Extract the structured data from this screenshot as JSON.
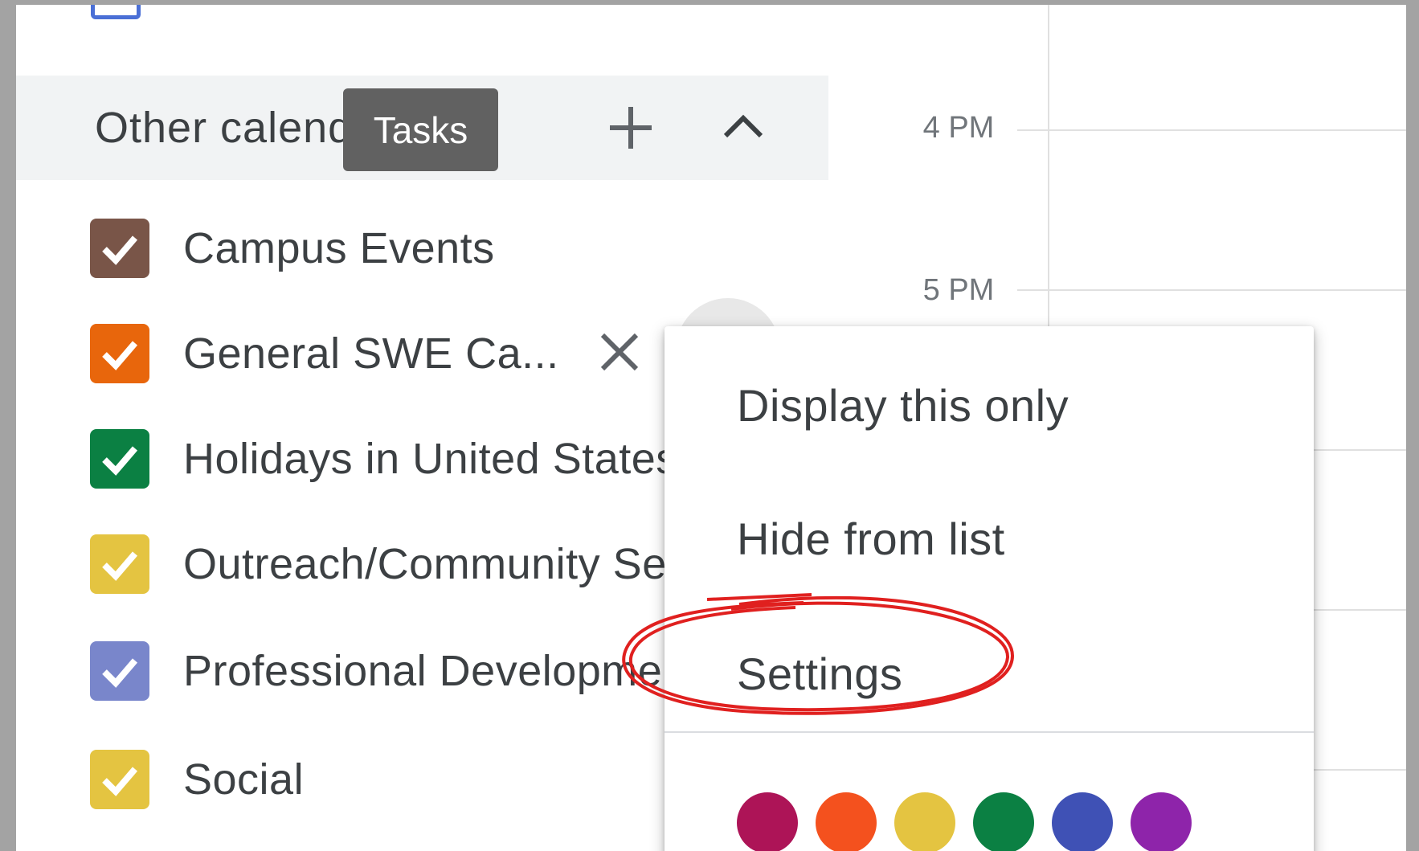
{
  "times": [
    "4 PM",
    "5 PM"
  ],
  "section": {
    "title": "Other calendars",
    "tooltip": "Tasks"
  },
  "calendars": [
    {
      "label": "Campus Events",
      "color": "#795548"
    },
    {
      "label": "General SWE Ca...",
      "color": "#e8660c"
    },
    {
      "label": "Holidays in United States",
      "color": "#0b8043"
    },
    {
      "label": "Outreach/Community Service",
      "color": "#e4c441"
    },
    {
      "label": "Professional Development",
      "color": "#7986cb"
    },
    {
      "label": "Social",
      "color": "#e4c441"
    }
  ],
  "menu": {
    "items": [
      "Display this only",
      "Hide from list",
      "Settings"
    ],
    "colors": [
      "#ad1457",
      "#f4511e",
      "#e4c441",
      "#0b8043",
      "#3f51b5",
      "#8e24aa"
    ]
  },
  "annotation_color": "#e0201f"
}
